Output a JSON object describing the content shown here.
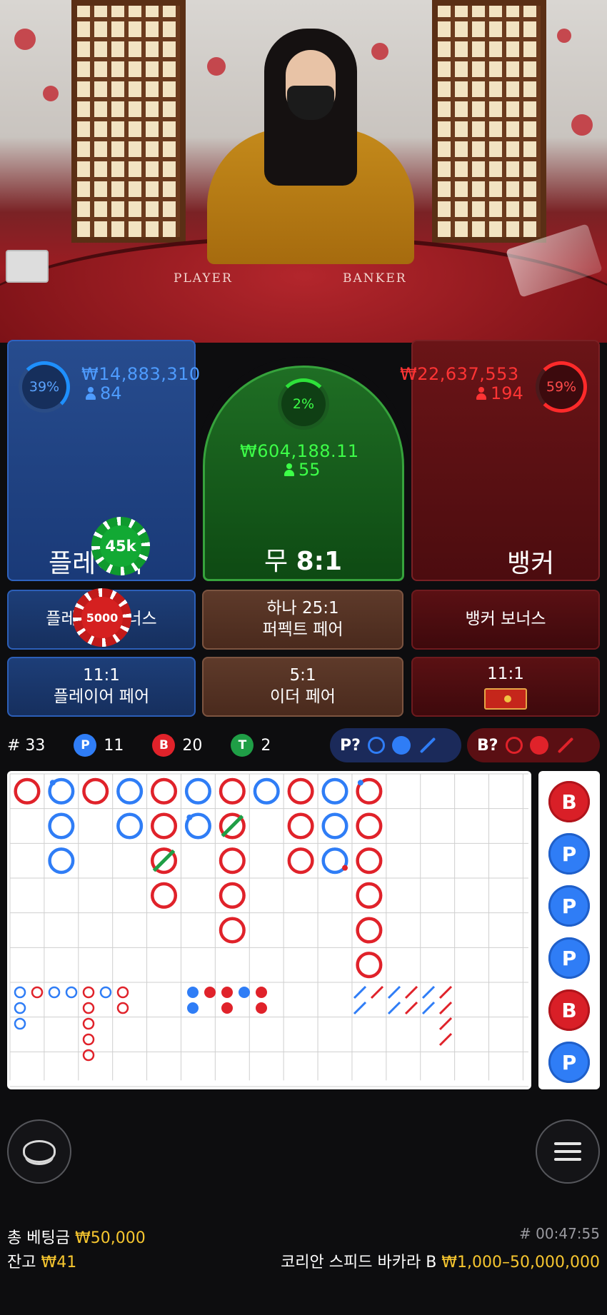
{
  "video": {
    "felt_player": "PLAYER",
    "felt_banker": "BANKER"
  },
  "player": {
    "percent": "39%",
    "amount": "₩14,883,310",
    "count": "84",
    "label": "플레이어",
    "chip": "45k"
  },
  "tie": {
    "percent": "2%",
    "amount": "₩604,188.11",
    "count": "55",
    "label_name": "무",
    "label_odds": "8:1"
  },
  "banker": {
    "percent": "59%",
    "amount": "₩22,637,553",
    "count": "194",
    "label": "뱅커"
  },
  "side_bets": {
    "player_bonus": "플레이어 보너스",
    "player_bonus_chip": "5000",
    "perfect_pair_line1": "하나 25:1",
    "perfect_pair_line2": "퍼펙트 페어",
    "banker_bonus": "뱅커 보너스",
    "player_pair_odds": "11:1",
    "player_pair": "플레이어 페어",
    "either_pair_odds": "5:1",
    "either_pair": "이더 페어",
    "banker_pair_odds": "11:1",
    "banker_pair_icon": "red-envelope-icon"
  },
  "stats": {
    "round_label": "# 33",
    "player_letter": "P",
    "player_count": "11",
    "banker_letter": "B",
    "banker_count": "20",
    "tie_letter": "T",
    "tie_count": "2"
  },
  "predict": {
    "player": "P?",
    "banker": "B?"
  },
  "big_road": [
    [
      "B",
      "Pt",
      "B",
      "P",
      "B",
      "P",
      "B",
      "P",
      "B",
      "P",
      "Bt"
    ],
    [
      "",
      "P",
      "",
      "P",
      "B",
      "Pt",
      "Bx",
      "",
      "B",
      "P",
      "B"
    ],
    [
      "",
      "P",
      "",
      "",
      "Bx",
      "",
      "B",
      "",
      "B",
      "Pp",
      "B"
    ],
    [
      "",
      "",
      "",
      "",
      "B",
      "",
      "B",
      "",
      "",
      "",
      "B"
    ],
    [
      "",
      "",
      "",
      "",
      "",
      "",
      "B",
      "",
      "",
      "",
      "B"
    ],
    [
      "",
      "",
      "",
      "",
      "",
      "",
      "",
      "",
      "",
      "",
      "B"
    ]
  ],
  "bead_road": [
    "B",
    "P",
    "P",
    "P",
    "B",
    "P"
  ],
  "colors": {
    "player": "#2f7df6",
    "banker": "#e0222a",
    "tie": "#1f9e46",
    "gold": "#f6c62f"
  },
  "footer": {
    "total_bet_label": "총 베팅금",
    "total_bet_value": "₩50,000",
    "balance_label": "잔고",
    "balance_value": "₩41",
    "game_id": "# 00:47:55",
    "table_name": "코리안 스피드 바카라 B",
    "limits": "₩1,000–50,000,000"
  },
  "icons": {
    "left_button": "chip-stack-icon",
    "right_button": "menu-icon"
  }
}
